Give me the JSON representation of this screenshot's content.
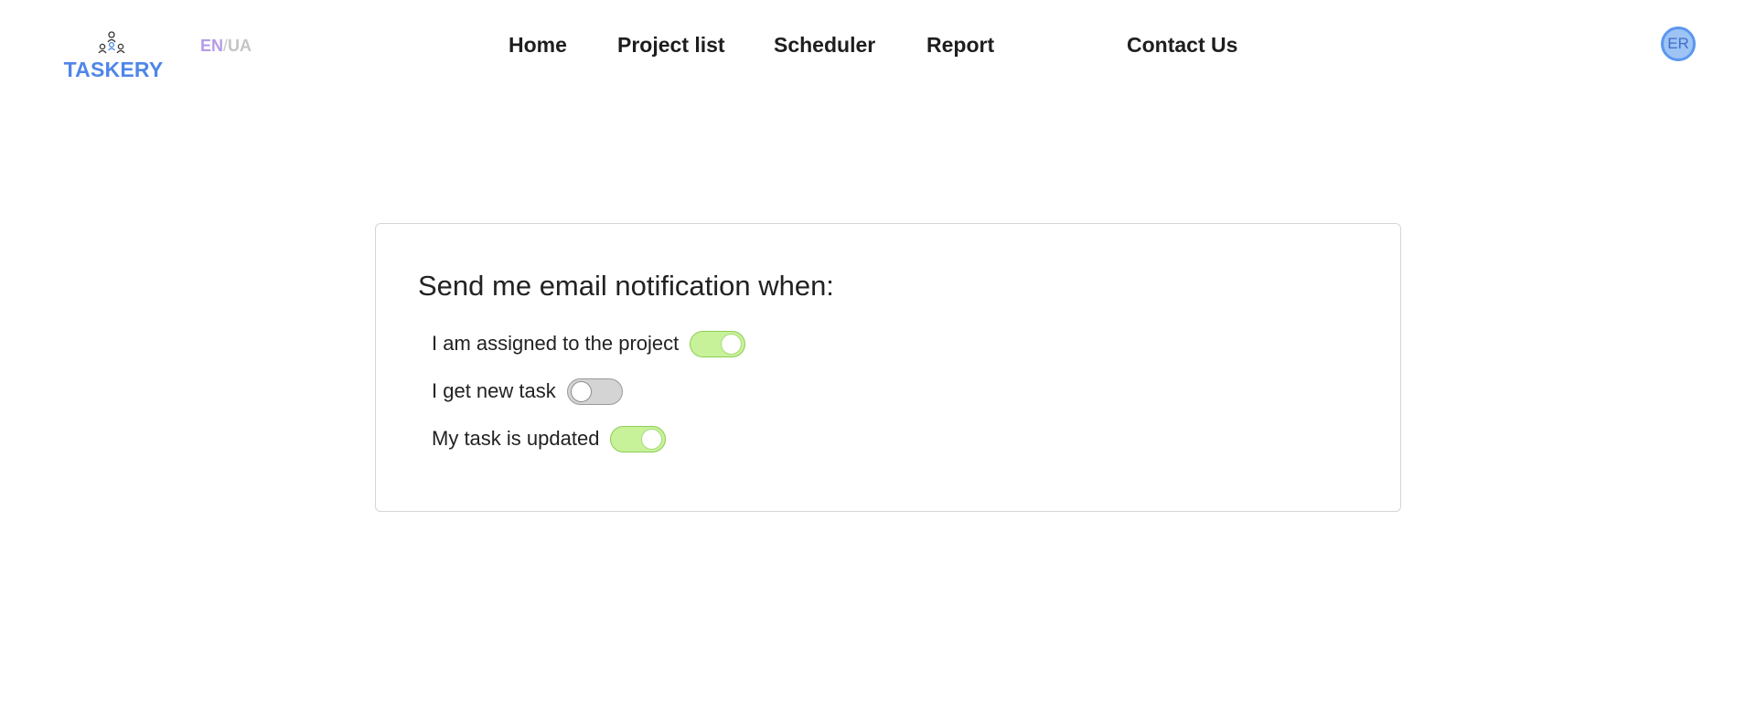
{
  "header": {
    "logo_text": "TASKERY",
    "lang": {
      "en": "EN",
      "separator": "/",
      "ua": "UA",
      "active": "EN"
    },
    "nav": [
      {
        "label": "Home"
      },
      {
        "label": "Project list"
      },
      {
        "label": "Scheduler"
      },
      {
        "label": "Report"
      },
      {
        "label": "Contact Us"
      }
    ],
    "avatar_initials": "ER"
  },
  "notifications": {
    "title": "Send me email notification when:",
    "options": [
      {
        "label": "I am assigned to the project",
        "enabled": true
      },
      {
        "label": "I get new task",
        "enabled": false
      },
      {
        "label": "My task is updated",
        "enabled": true
      }
    ]
  },
  "colors": {
    "brand": "#4f86e8",
    "lang_active": "#b59ce8",
    "toggle_on": "#c8f29a",
    "toggle_off": "#d4d4d4",
    "avatar_fill": "#9ec3f5"
  }
}
